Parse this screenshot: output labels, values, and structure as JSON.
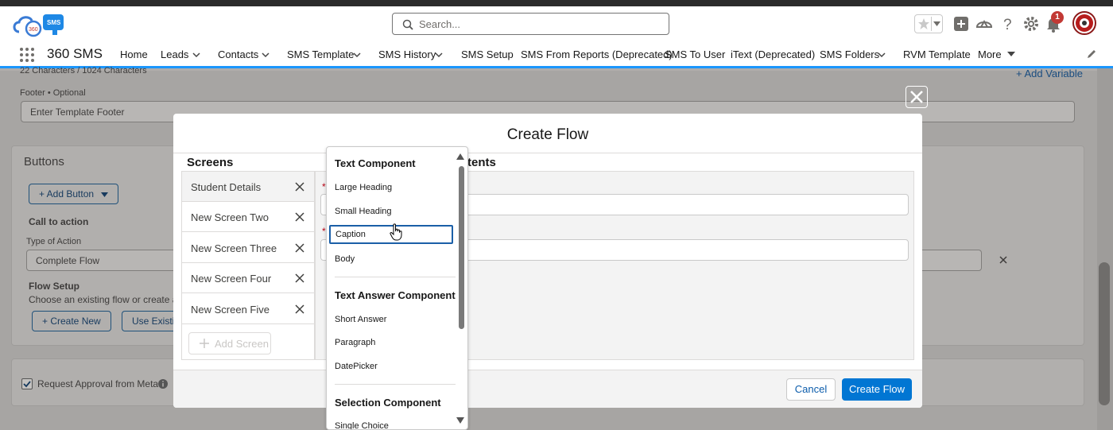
{
  "header": {
    "search_placeholder": "Search...",
    "notification_count": "1",
    "logo_text": "SMS"
  },
  "nav": {
    "app_name": "360 SMS",
    "items": [
      {
        "label": "Home",
        "has_menu": false
      },
      {
        "label": "Leads",
        "has_menu": true
      },
      {
        "label": "Contacts",
        "has_menu": true
      },
      {
        "label": "SMS Template",
        "has_menu": true
      },
      {
        "label": "SMS History",
        "has_menu": true
      },
      {
        "label": "SMS Setup",
        "has_menu": false
      },
      {
        "label": "SMS From Reports (Deprecated)",
        "has_menu": false
      },
      {
        "label": "SMS To User",
        "has_menu": false
      },
      {
        "label": "iText (Deprecated)",
        "has_menu": false
      },
      {
        "label": "SMS Folders",
        "has_menu": true
      },
      {
        "label": "RVM Template",
        "has_menu": false
      },
      {
        "label": "More",
        "has_menu": true
      }
    ]
  },
  "background": {
    "char_count": "22 Characters / 1024 Characters",
    "add_variable": "+ Add Variable",
    "footer_label": "Footer • Optional",
    "footer_placeholder": "Enter Template Footer",
    "buttons_title": "Buttons",
    "add_button": "+ Add Button",
    "call_to_action": "Call to action",
    "type_of_action_label": "Type of Action",
    "type_of_action_value": "Complete Flow",
    "flow_setup_title": "Flow Setup",
    "flow_setup_desc": "Choose an existing flow or create a n",
    "create_new": "+ Create New",
    "use_existing": "Use Existin",
    "request_approval": "Request Approval from Meta"
  },
  "modal": {
    "title": "Create Flow",
    "screens_heading": "Screens",
    "contents_heading": "tents",
    "screens": [
      {
        "label": "Student Details",
        "active": true
      },
      {
        "label": "New Screen Two",
        "active": false
      },
      {
        "label": "New Screen Three",
        "active": false
      },
      {
        "label": "New Screen Four",
        "active": false
      },
      {
        "label": "New Screen Five",
        "active": false
      }
    ],
    "add_screen": "Add Screen",
    "cancel": "Cancel",
    "create_flow": "Create Flow"
  },
  "dropdown": {
    "groups": [
      {
        "title": "Text Component",
        "items": [
          "Large Heading",
          "Small Heading",
          "Caption",
          "Body"
        ]
      },
      {
        "title": "Text Answer Component",
        "items": [
          "Short Answer",
          "Paragraph",
          "DatePicker"
        ]
      },
      {
        "title": "Selection Component",
        "items": [
          "Single Choice"
        ]
      }
    ],
    "selected": "Caption"
  },
  "colors": {
    "brand_blue": "#0176d3",
    "nav_underline": "#1b96ff",
    "badge_red": "#c23934",
    "overlay": "#a7a5a3"
  }
}
